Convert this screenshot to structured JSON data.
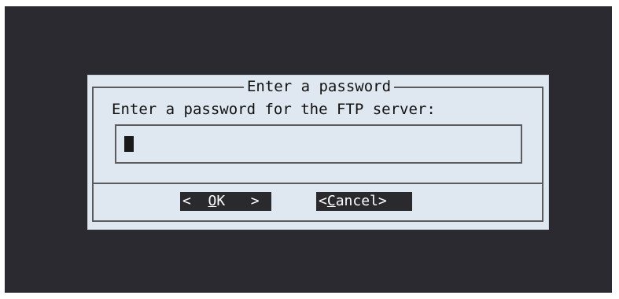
{
  "dialog": {
    "title": "Enter a password",
    "prompt": "Enter a password for the FTP server:",
    "password_value": ""
  },
  "buttons": {
    "ok": {
      "left": "<",
      "pad_left": " ",
      "accel": "O",
      "rest": "K",
      "pad_right": " ",
      "right": ">"
    },
    "cancel": {
      "left": "<",
      "accel": "C",
      "rest": "ancel",
      "right": ">"
    }
  },
  "colors": {
    "screen_bg": "#2b2a30",
    "dialog_bg": "#dfe8f1",
    "button_bg": "#2a2a2e",
    "button_fg": "#ffffff"
  }
}
